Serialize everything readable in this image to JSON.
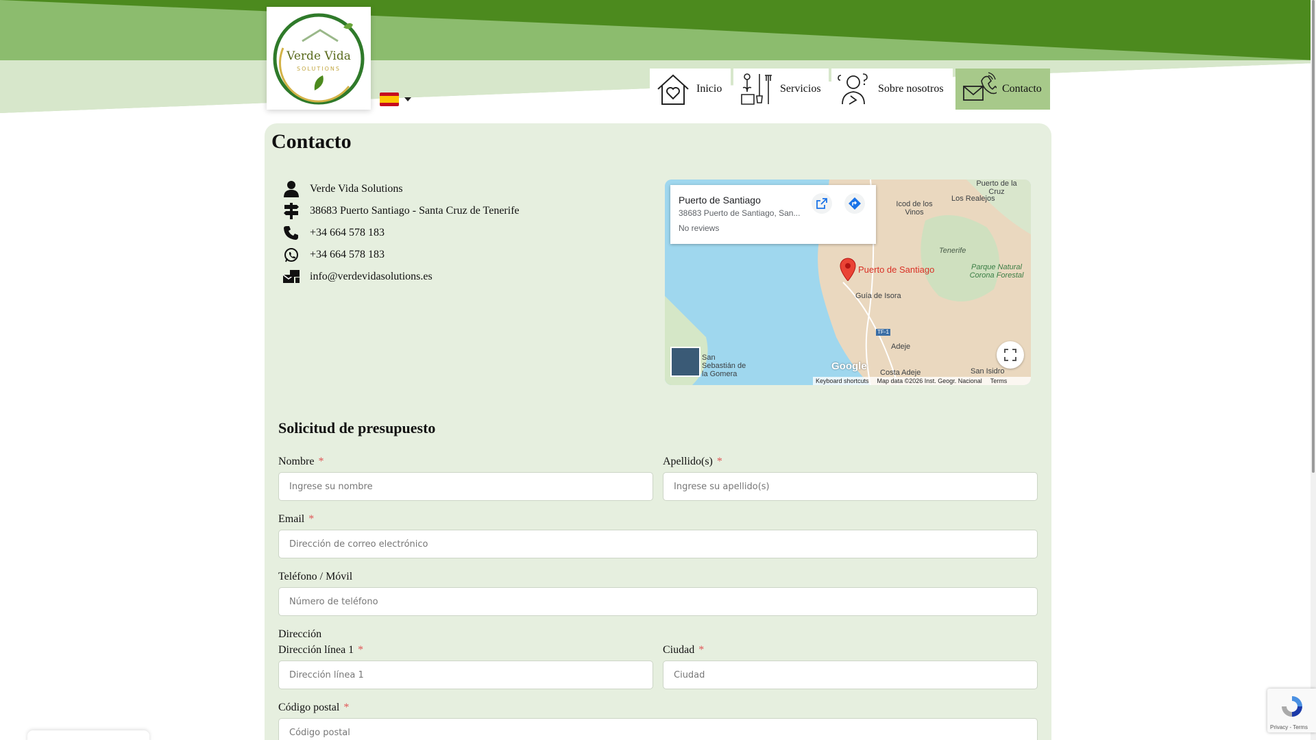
{
  "brand": {
    "logo_title": "Verde Vida",
    "logo_subtitle": "SOLUTIONS",
    "primary_green": "#4c8a1e",
    "light_green": "#a7c98a",
    "panel_bg": "#e6efdf"
  },
  "language": {
    "selected": "es",
    "flag_icon": "spain-flag-icon"
  },
  "nav": {
    "items": [
      {
        "label": "Inicio",
        "icon": "home-heart-icon",
        "active": false
      },
      {
        "label": "Servicios",
        "icon": "garden-tools-icon",
        "active": false
      },
      {
        "label": "Sobre nosotros",
        "icon": "person-thinking-icon",
        "active": false
      },
      {
        "label": "Contacto",
        "icon": "mail-phone-icon",
        "active": true
      }
    ]
  },
  "page": {
    "title": "Contacto"
  },
  "contact": {
    "company": "Verde Vida Solutions",
    "address": "38683 Puerto Santiago - Santa Cruz de Tenerife",
    "phone": "+34 664 578 183",
    "whatsapp": "+34 664 578 183",
    "email": "info@verdevidasolutions.es"
  },
  "map": {
    "card_title": "Puerto de Santiago",
    "card_address": "38683 Puerto de Santiago, San...",
    "card_reviews": "No reviews",
    "pin_label": "Puerto de Santiago",
    "labels": {
      "puerto_cruz": "Puerto de la Cruz",
      "icod": "Icod de los Vinos",
      "realejos": "Los Realejos",
      "tenerife": "Tenerife",
      "parque": "Parque Natural Corona Forestal",
      "guia": "Guía de Isora",
      "road": "TF-1",
      "adeje": "Adeje",
      "costa_adeje": "Costa Adeje",
      "san_isidro": "San Isidro",
      "gomera": "San Sebastián de la Gomera"
    },
    "google": "Google",
    "footer_shortcuts": "Keyboard shortcuts",
    "footer_data": "Map data ©2026 Inst. Geogr. Nacional",
    "footer_terms": "Terms"
  },
  "form": {
    "title": "Solicitud de presupuesto",
    "nombre_label": "Nombre",
    "nombre_placeholder": "Ingrese su nombre",
    "apellido_label": "Apellido(s)",
    "apellido_placeholder": "Ingrese su apellido(s)",
    "email_label": "Email",
    "email_placeholder": "Dirección de correo electrónico",
    "telefono_label": "Teléfono / Móvil",
    "telefono_placeholder": "Número de teléfono",
    "direccion_label": "Dirección",
    "linea1_label": "Dirección línea 1",
    "linea1_placeholder": "Dirección línea 1",
    "ciudad_label": "Ciudad",
    "ciudad_placeholder": "Ciudad",
    "postal_label": "Código postal",
    "postal_placeholder": "Código postal",
    "required_mark": "*"
  },
  "recaptcha": {
    "links": "Privacy - Terms"
  }
}
